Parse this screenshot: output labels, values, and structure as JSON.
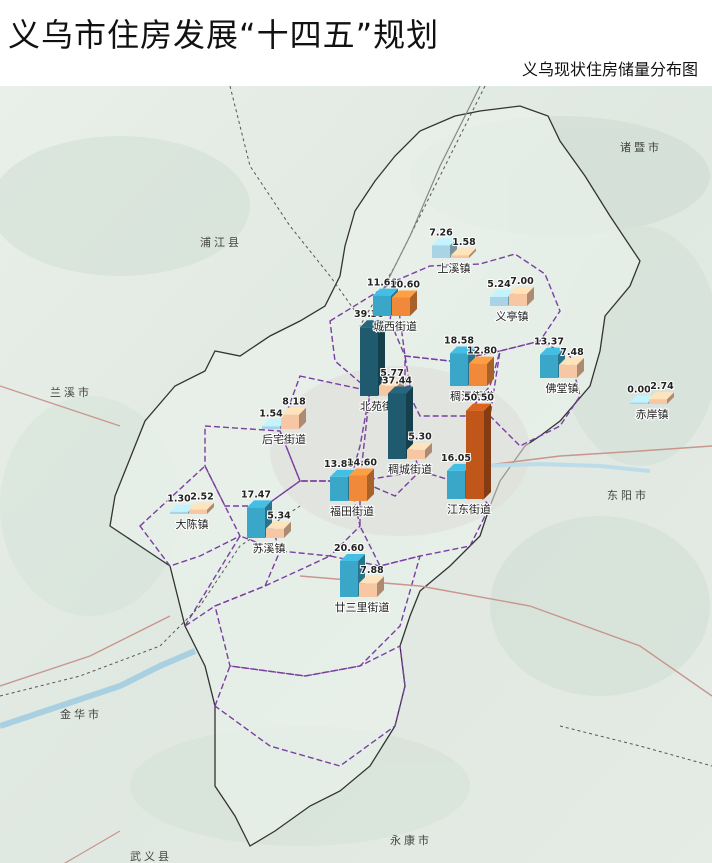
{
  "header": {
    "title": "义乌市住房发展“十四五”规划",
    "subtitle": "义乌现状住房储量分布图"
  },
  "map": {
    "region_labels": [
      "诸暨市",
      "浦江县",
      "兰溪市",
      "东阳市",
      "金华市",
      "永康市",
      "武义县"
    ],
    "colors": {
      "bar_blue": "#3aa6c8",
      "bar_dark": "#1f5a6e",
      "bar_orange": "#f08a3a",
      "bar_dark_orange": "#c0561a",
      "bar_light_blue": "#a9d4e6",
      "bar_peach": "#f7c6a3",
      "boundary_purple": "#7a3fa0"
    }
  },
  "chart_data": {
    "type": "bar",
    "categories": [
      "大陈镇",
      "苏溪镇",
      "后宅街道",
      "北苑街道",
      "稠城街道",
      "福田街道",
      "廿三里街道",
      "城西街道",
      "上溪镇",
      "稠江街道",
      "江东街道",
      "义亭镇",
      "佛堂镇",
      "赤岸镇"
    ],
    "series": [
      {
        "values": [
          1.3,
          17.47,
          1.54,
          39.3,
          37.44,
          13.8,
          20.6,
          11.66,
          7.26,
          18.58,
          16.05,
          5.24,
          13.37,
          0.0
        ]
      },
      {
        "values": [
          2.52,
          5.34,
          8.18,
          5.77,
          5.3,
          14.6,
          7.88,
          10.6,
          1.58,
          12.8,
          50.5,
          7.0,
          7.48,
          2.74
        ]
      }
    ],
    "value_labels": [
      [
        "1.30",
        "2.52"
      ],
      [
        "17.47",
        "5.34"
      ],
      [
        "1.54",
        "8.18"
      ],
      [
        "39.30",
        "5.77"
      ],
      [
        "37.44",
        "5.30"
      ],
      [
        "13.80",
        "14.60"
      ],
      [
        "20.60",
        "7.88"
      ],
      [
        "11.66",
        "10.60"
      ],
      [
        "7.26",
        "1.58"
      ],
      [
        "18.58",
        "12.80"
      ],
      [
        "16.05",
        "50.50"
      ],
      [
        "5.24",
        "7.00"
      ],
      [
        "13.37",
        "7.48"
      ],
      [
        "0.00",
        "2.74"
      ]
    ]
  }
}
